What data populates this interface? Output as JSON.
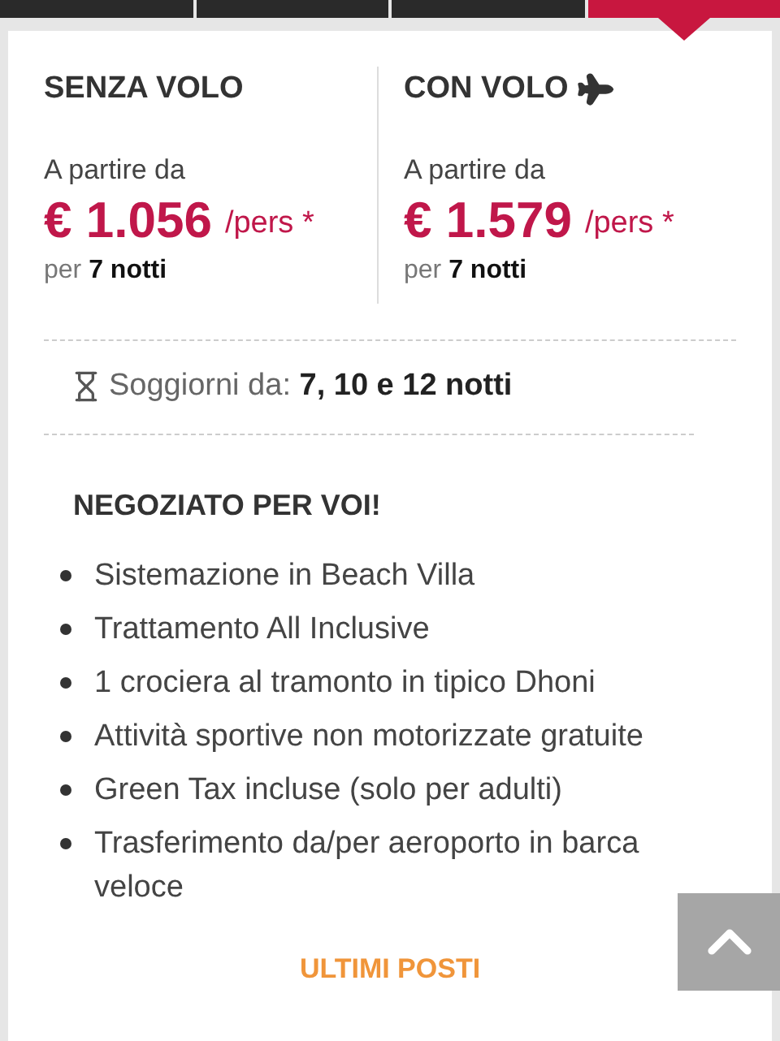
{
  "tabs": [
    {
      "selected": false
    },
    {
      "selected": false
    },
    {
      "selected": false
    },
    {
      "selected": true
    }
  ],
  "offers": [
    {
      "title": "SENZA VOLO",
      "flight": false,
      "from_label": "A partire da",
      "price": "€ 1.056",
      "unit": "/pers *",
      "nights": "per **7 notti**"
    },
    {
      "title": "CON VOLO",
      "flight": true,
      "from_label": "A partire da",
      "price": "€ 1.579",
      "unit": "/pers *",
      "nights": "per **7 notti**"
    }
  ],
  "stays": "Soggiorni da: **7, 10 e 12 notti**",
  "negotiated": {
    "title": "NEGOZIATO PER VOI!",
    "items": [
      "Sistemazione in Beach Villa",
      "Trattamento All Inclusive",
      "1 crociera al tramonto in tipico Dhoni",
      "Attività sportive non motorizzate gratuite",
      "Green Tax incluse (solo per adulti)",
      "Trasferimento da/per aeroporto in barca veloce"
    ]
  },
  "badge": "ULTIMI POSTI"
}
